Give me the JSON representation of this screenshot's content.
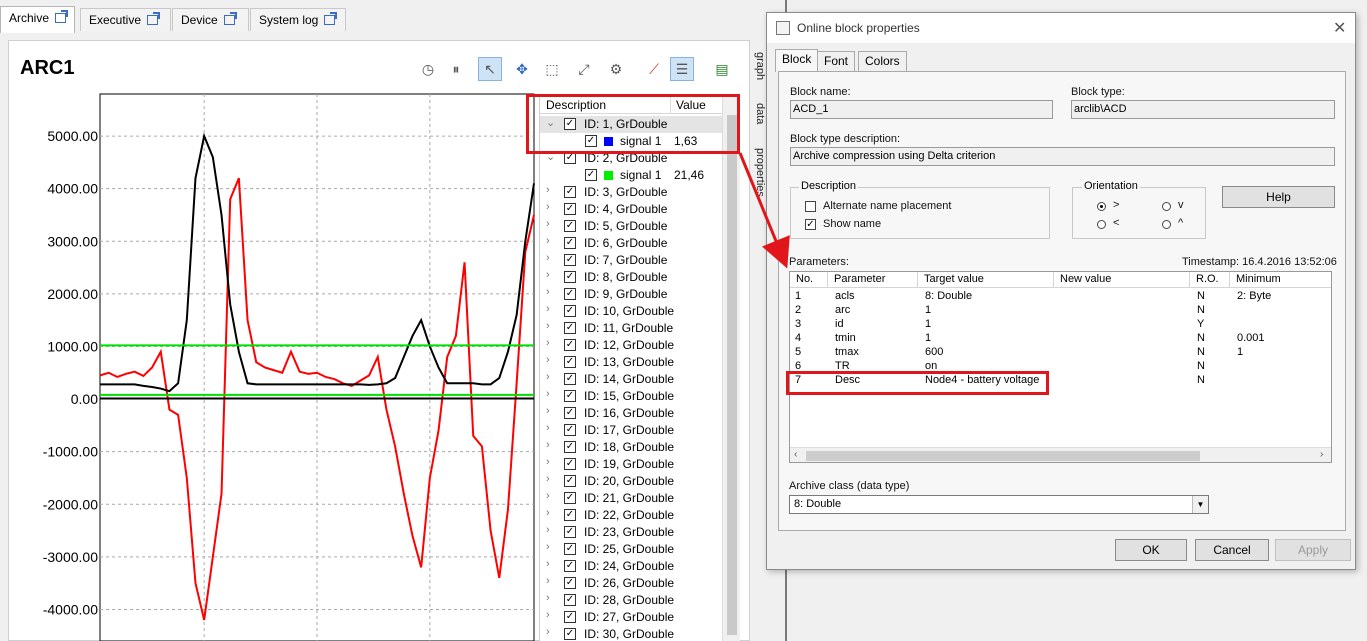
{
  "tabs": [
    {
      "label": "Archive",
      "active": true
    },
    {
      "label": "Executive",
      "active": false
    },
    {
      "label": "Device",
      "active": false
    },
    {
      "label": "System log",
      "active": false
    }
  ],
  "archive": {
    "title": "ARC1",
    "toolbar_icons": [
      "play-icon",
      "pause-icon",
      "pointer-icon",
      "pan-icon",
      "zoom-rect-icon",
      "zoom-fit-icon",
      "gear-icon",
      "trend-icon",
      "list-icon",
      "export-icon"
    ],
    "side_tabs": [
      "graph",
      "data",
      "properties"
    ]
  },
  "chart_data": {
    "type": "line",
    "title": "",
    "xlabel": "",
    "ylabel": "",
    "ylim": [
      -4600,
      5800
    ],
    "yticks": [
      "5000.00",
      "4000.00",
      "3000.00",
      "2000.00",
      "1000.00",
      "0.00",
      "-1000.00",
      "-2000.00",
      "-3000.00",
      "-4000.00"
    ],
    "ytick_values": [
      5000,
      4000,
      3000,
      2000,
      1000,
      0,
      -1000,
      -2000,
      -3000,
      -4000
    ],
    "grid": true,
    "series": [
      {
        "color": "#ff0000",
        "x": [
          0,
          2,
          4,
          6,
          8,
          10,
          12,
          14,
          16,
          18,
          20,
          22,
          24,
          26,
          28,
          30,
          32,
          34,
          36,
          38,
          40,
          42,
          44,
          46,
          48,
          50,
          52,
          54,
          56,
          58,
          60,
          62,
          64,
          66,
          68,
          70,
          72,
          74,
          76,
          78,
          80,
          82,
          84,
          86,
          88,
          90,
          92,
          94,
          96,
          98,
          100
        ],
        "y": [
          450,
          500,
          420,
          480,
          520,
          440,
          600,
          900,
          -200,
          -300,
          -1500,
          -3500,
          -4200,
          -3000,
          -1800,
          3800,
          4200,
          1500,
          700,
          600,
          550,
          500,
          900,
          520,
          480,
          500,
          420,
          380,
          300,
          250,
          350,
          450,
          800,
          -200,
          -900,
          -1800,
          -2600,
          -3200,
          -1500,
          -600,
          800,
          1200,
          2600,
          -700,
          -900,
          -2500,
          -3400,
          -2100,
          300,
          2800,
          3500
        ]
      },
      {
        "color": "#000000",
        "x": [
          0,
          2,
          4,
          6,
          8,
          10,
          12,
          14,
          16,
          18,
          20,
          22,
          24,
          26,
          28,
          30,
          32,
          34,
          36,
          38,
          40,
          42,
          44,
          46,
          48,
          50,
          52,
          54,
          56,
          58,
          60,
          62,
          64,
          66,
          68,
          70,
          72,
          74,
          76,
          78,
          80,
          82,
          84,
          86,
          88,
          90,
          92,
          94,
          96,
          98,
          100
        ],
        "y": [
          280,
          280,
          280,
          280,
          280,
          250,
          230,
          200,
          150,
          300,
          1500,
          4200,
          5000,
          4600,
          3500,
          1800,
          900,
          300,
          280,
          280,
          280,
          280,
          280,
          280,
          280,
          280,
          280,
          280,
          280,
          280,
          280,
          270,
          280,
          300,
          400,
          800,
          1200,
          1500,
          1000,
          600,
          300,
          300,
          300,
          300,
          280,
          280,
          400,
          900,
          1600,
          3000,
          4100
        ]
      },
      {
        "color": "#00e000",
        "x": [
          0,
          100
        ],
        "y": [
          1020,
          1020
        ]
      },
      {
        "color": "#00e000",
        "x": [
          0,
          100
        ],
        "y": [
          80,
          80
        ]
      },
      {
        "color": "#000000",
        "x": [
          0,
          100
        ],
        "y": [
          10,
          10
        ]
      }
    ]
  },
  "tree": {
    "col_description": "Description",
    "col_value": "Value",
    "rows": [
      {
        "label": "ID: 1, GrDouble",
        "kind": "group",
        "expanded": true,
        "selected": true
      },
      {
        "label": "signal 1",
        "kind": "signal",
        "color": "#0000ff",
        "value": "1,63"
      },
      {
        "label": "ID: 2, GrDouble",
        "kind": "group",
        "expanded": true
      },
      {
        "label": "signal 1",
        "kind": "signal",
        "color": "#00ee00",
        "value": "21,46"
      },
      {
        "label": "ID: 3, GrDouble",
        "kind": "group"
      },
      {
        "label": "ID: 4, GrDouble",
        "kind": "group"
      },
      {
        "label": "ID: 5, GrDouble",
        "kind": "group"
      },
      {
        "label": "ID: 6, GrDouble",
        "kind": "group"
      },
      {
        "label": "ID: 7, GrDouble",
        "kind": "group"
      },
      {
        "label": "ID: 8, GrDouble",
        "kind": "group"
      },
      {
        "label": "ID: 9, GrDouble",
        "kind": "group"
      },
      {
        "label": "ID: 10, GrDouble",
        "kind": "group"
      },
      {
        "label": "ID: 11, GrDouble",
        "kind": "group"
      },
      {
        "label": "ID: 12, GrDouble",
        "kind": "group"
      },
      {
        "label": "ID: 13, GrDouble",
        "kind": "group"
      },
      {
        "label": "ID: 14, GrDouble",
        "kind": "group"
      },
      {
        "label": "ID: 15, GrDouble",
        "kind": "group"
      },
      {
        "label": "ID: 16, GrDouble",
        "kind": "group"
      },
      {
        "label": "ID: 17, GrDouble",
        "kind": "group"
      },
      {
        "label": "ID: 18, GrDouble",
        "kind": "group"
      },
      {
        "label": "ID: 19, GrDouble",
        "kind": "group"
      },
      {
        "label": "ID: 20, GrDouble",
        "kind": "group"
      },
      {
        "label": "ID: 21, GrDouble",
        "kind": "group"
      },
      {
        "label": "ID: 22, GrDouble",
        "kind": "group"
      },
      {
        "label": "ID: 23, GrDouble",
        "kind": "group"
      },
      {
        "label": "ID: 25, GrDouble",
        "kind": "group"
      },
      {
        "label": "ID: 24, GrDouble",
        "kind": "group"
      },
      {
        "label": "ID: 26, GrDouble",
        "kind": "group"
      },
      {
        "label": "ID: 28, GrDouble",
        "kind": "group"
      },
      {
        "label": "ID: 27, GrDouble",
        "kind": "group"
      },
      {
        "label": "ID: 30, GrDouble",
        "kind": "group"
      }
    ]
  },
  "dialog": {
    "title": "Online block properties",
    "close_glyph": "✕",
    "tabs": [
      "Block",
      "Font",
      "Colors"
    ],
    "block_name_label": "Block name:",
    "block_name": "ACD_1",
    "block_type_label": "Block type:",
    "block_type": "arclib\\ACD",
    "block_type_desc_label": "Block type description:",
    "block_type_desc": "Archive compression using Delta criterion",
    "description_group": "Description",
    "alt_name_label": "Alternate name placement",
    "alt_name_checked": false,
    "show_name_label": "Show name",
    "show_name_checked": true,
    "orientation_group": "Orientation",
    "orientation_options": [
      ">",
      "v",
      "<",
      "^"
    ],
    "orientation_selected": ">",
    "help_label": "Help",
    "parameters_label": "Parameters:",
    "timestamp": "Timestamp: 16.4.2016 13:52:06",
    "param_headers": [
      "No.",
      "Parameter",
      "Target value",
      "New value",
      "R.O.",
      "Minimum"
    ],
    "params": [
      {
        "no": "1",
        "param": "acls",
        "target": "8: Double",
        "new": "",
        "ro": "N",
        "min": "2: Byte"
      },
      {
        "no": "2",
        "param": "arc",
        "target": "1",
        "new": "",
        "ro": "N",
        "min": ""
      },
      {
        "no": "3",
        "param": "id",
        "target": "1",
        "new": "",
        "ro": "Y",
        "min": ""
      },
      {
        "no": "4",
        "param": "tmin",
        "target": "1",
        "new": "",
        "ro": "N",
        "min": "0.001"
      },
      {
        "no": "5",
        "param": "tmax",
        "target": "600",
        "new": "",
        "ro": "N",
        "min": "1"
      },
      {
        "no": "6",
        "param": "TR",
        "target": "on",
        "new": "",
        "ro": "N",
        "min": ""
      },
      {
        "no": "7",
        "param": "Desc",
        "target": "Node4 - battery voltage",
        "new": "",
        "ro": "N",
        "min": ""
      }
    ],
    "archive_class_label": "Archive class (data type)",
    "archive_class_value": "8: Double",
    "ok_label": "OK",
    "cancel_label": "Cancel",
    "apply_label": "Apply"
  },
  "colors": {
    "annotation_red": "#e0161b",
    "selection_blue": "#cfe3f7",
    "signal1_blue": "#0000ff",
    "signal2_green": "#00ee00"
  }
}
